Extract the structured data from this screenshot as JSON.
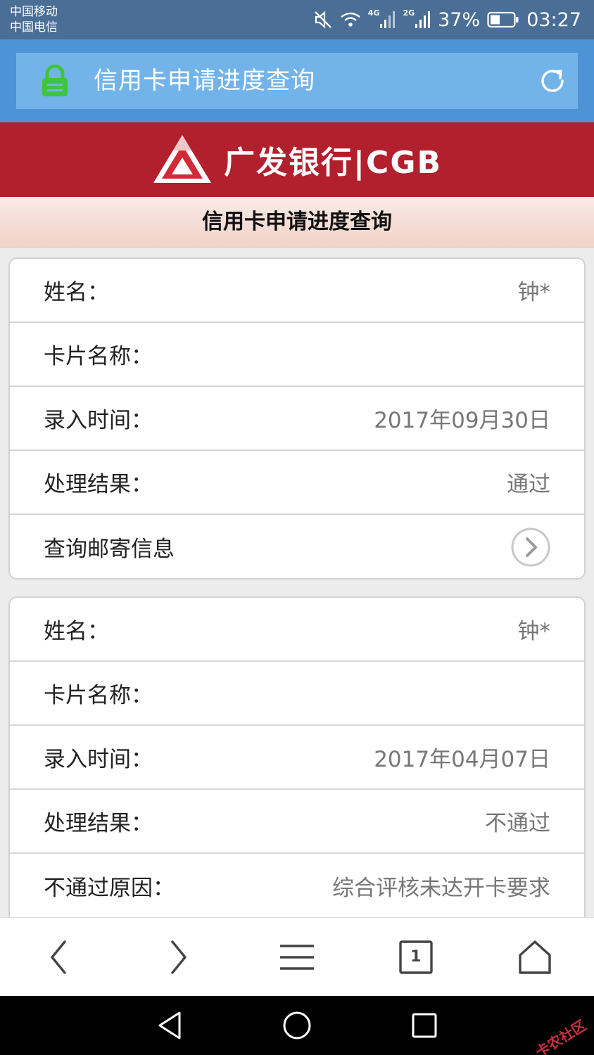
{
  "status_bar": {
    "carrier_1": "中国移动",
    "carrier_2": "中国电信",
    "network_1": "4G",
    "network_2": "2G",
    "battery": "37%",
    "time": "03:27"
  },
  "address_bar": {
    "title": "信用卡申请进度查询",
    "lock_icon": "lock-icon",
    "reload_icon": "reload-icon"
  },
  "bank": {
    "logo_text": "广发银行|CGB",
    "brand_color": "#b21f2d"
  },
  "page_title": "信用卡申请进度查询",
  "records": [
    {
      "name_label": "姓名：",
      "name_value": "钟*",
      "card_label": "卡片名称：",
      "card_value": "",
      "date_label": "录入时间：",
      "date_value": "2017年09月30日",
      "result_label": "处理结果：",
      "result_value": "通过",
      "mail_label": "查询邮寄信息"
    },
    {
      "name_label": "姓名：",
      "name_value": "钟*",
      "card_label": "卡片名称：",
      "card_value": "",
      "date_label": "录入时间：",
      "date_value": "2017年04月07日",
      "result_label": "处理结果：",
      "result_value": "不通过",
      "reason_label": "不通过原因：",
      "reason_value": "综合评核未达开卡要求"
    }
  ],
  "toolbar": {
    "tab_count": "1"
  },
  "watermark": "卡农社区"
}
